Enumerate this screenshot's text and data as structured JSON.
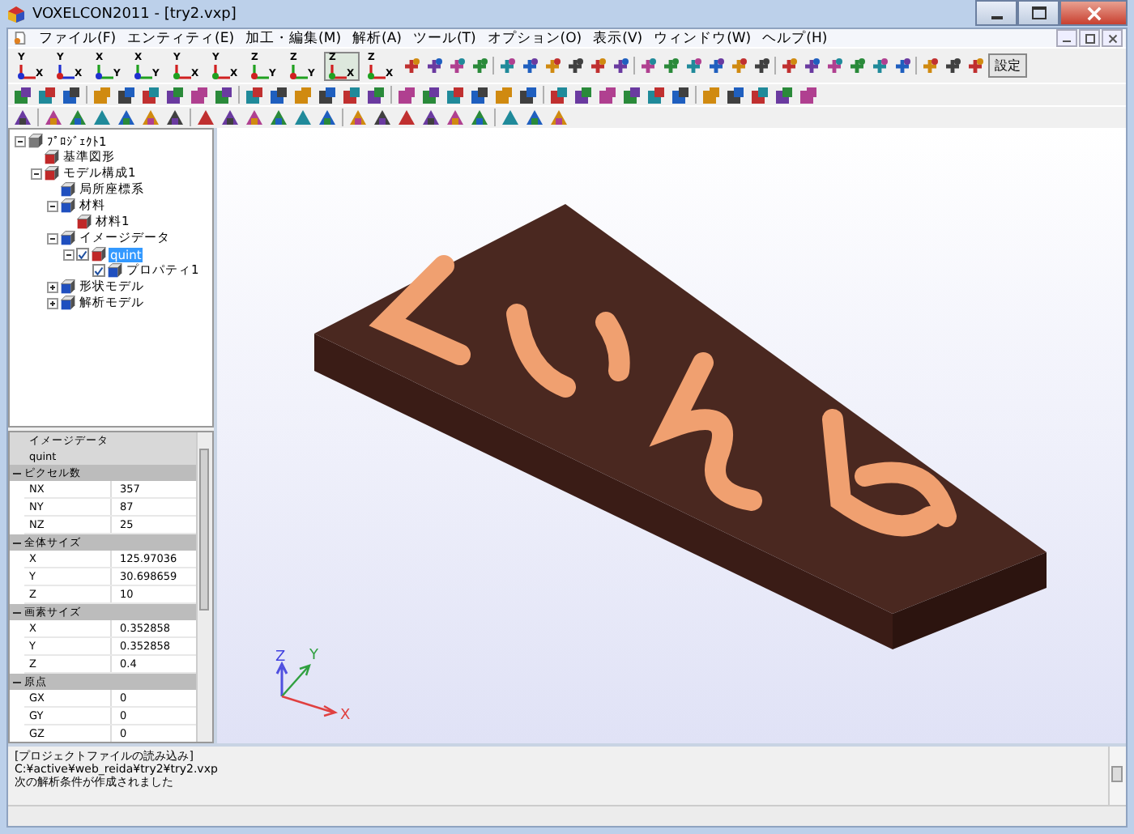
{
  "window": {
    "title": "VOXELCON2011 - [try2.vxp]"
  },
  "menu": [
    "ファイル(F)",
    "エンティティ(E)",
    "加工・編集(M)",
    "解析(A)",
    "ツール(T)",
    "オプション(O)",
    "表示(V)",
    "ウィンドウ(W)",
    "ヘルプ(H)"
  ],
  "axis_view_buttons": [
    {
      "top": "Y",
      "side": "X",
      "selected": false
    },
    {
      "top": "Y",
      "side": "X",
      "selected": false
    },
    {
      "top": "X",
      "side": "Y",
      "selected": false
    },
    {
      "top": "X",
      "side": "Y",
      "selected": false
    },
    {
      "top": "Y",
      "side": "X",
      "selected": false
    },
    {
      "top": "Y",
      "side": "X",
      "selected": false
    },
    {
      "top": "Z",
      "side": "Y",
      "selected": false
    },
    {
      "top": "Z",
      "side": "Y",
      "selected": false
    },
    {
      "top": "Z",
      "side": "X",
      "selected": true
    },
    {
      "top": "Z",
      "side": "X",
      "selected": false
    }
  ],
  "settings_button": "設定",
  "tree": [
    {
      "label": "ﾌﾟﾛｼﾞｪｸﾄ1",
      "expanded": true,
      "children": [
        {
          "label": "基準図形"
        },
        {
          "label": "モデル構成1",
          "expanded": true,
          "children": [
            {
              "label": "局所座標系"
            },
            {
              "label": "材料",
              "expanded": true,
              "children": [
                {
                  "label": "材料1"
                }
              ]
            },
            {
              "label": "イメージデータ",
              "expanded": true,
              "children": [
                {
                  "label": "quint",
                  "expanded": true,
                  "checked": true,
                  "selected": true,
                  "children": [
                    {
                      "label": "プロパティ1",
                      "checked": true,
                      "selected": false
                    }
                  ]
                }
              ]
            },
            {
              "label": "形状モデル",
              "expanded": false
            },
            {
              "label": "解析モデル",
              "expanded": false
            }
          ]
        }
      ]
    }
  ],
  "properties": {
    "title": "イメージデータ",
    "subtitle": "quint",
    "groups": [
      {
        "name": "ピクセル数",
        "expanded": true,
        "rows": [
          {
            "name": "NX",
            "value": "357"
          },
          {
            "name": "NY",
            "value": "87"
          },
          {
            "name": "NZ",
            "value": "25"
          }
        ]
      },
      {
        "name": "全体サイズ",
        "expanded": true,
        "rows": [
          {
            "name": "X",
            "value": "125.97036"
          },
          {
            "name": "Y",
            "value": "30.698659"
          },
          {
            "name": "Z",
            "value": "10"
          }
        ]
      },
      {
        "name": "画素サイズ",
        "expanded": true,
        "rows": [
          {
            "name": "X",
            "value": "0.352858"
          },
          {
            "name": "Y",
            "value": "0.352858"
          },
          {
            "name": "Z",
            "value": "0.4"
          }
        ]
      },
      {
        "name": "原点",
        "expanded": true,
        "rows": [
          {
            "name": "GX",
            "value": "0"
          },
          {
            "name": "GY",
            "value": "0"
          },
          {
            "name": "GZ",
            "value": "0"
          }
        ]
      }
    ]
  },
  "triad": {
    "x": "X",
    "y": "Y",
    "z": "Z"
  },
  "log": [
    "[プロジェクトファイルの読み込み]",
    "C:¥active¥web_reida¥try2¥try2.vxp",
    "次の解析条件が作成されました"
  ]
}
